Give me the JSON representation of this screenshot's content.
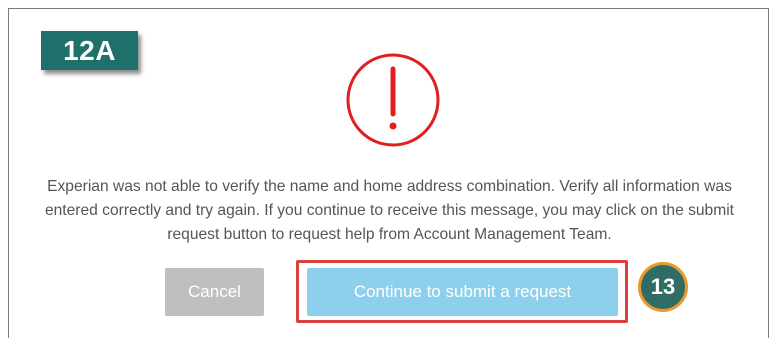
{
  "annotations": {
    "step_badge": "12A",
    "step_circle": "13"
  },
  "dialog": {
    "icon": "exclamation-circle-icon",
    "message": "Experian was not able to verify the name and home address combination. Verify all information was entered correctly and try again. If you continue to receive this message, you may click on the submit request button to request help from Account Management Team.",
    "cancel_label": "Cancel",
    "submit_label": "Continue to submit a request"
  },
  "colors": {
    "alert_red": "#e02020",
    "badge_teal": "#1f6f6b",
    "cancel_gray": "#bfbfbf",
    "submit_blue": "#8dd0ee",
    "highlight_red": "#d94040",
    "circle_border_orange": "#e89b2a"
  }
}
